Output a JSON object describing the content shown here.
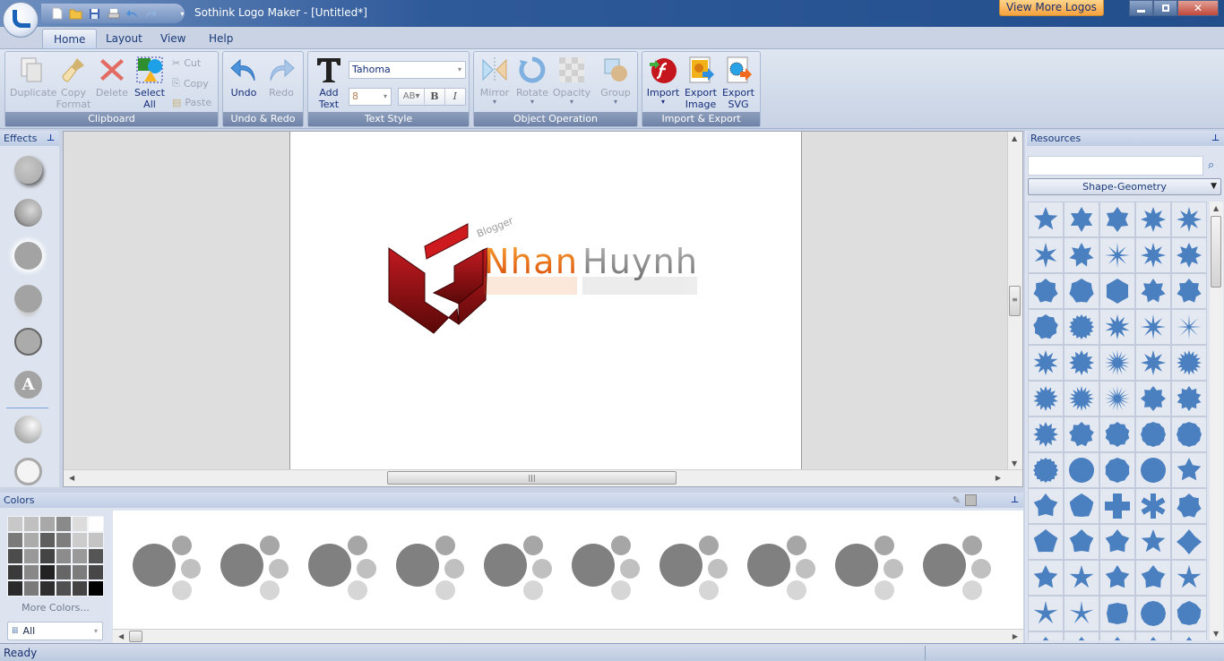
{
  "window": {
    "title": "Sothink Logo Maker - [Untitled*]",
    "view_more_label": "View More Logos",
    "minimize_icon": "minimize-icon",
    "restore_icon": "restore-icon",
    "close_icon": "close-icon"
  },
  "quick_access": [
    "new-icon",
    "open-icon",
    "save-icon",
    "print-icon",
    "undo-icon",
    "redo-icon",
    "customize-icon"
  ],
  "tabs": [
    {
      "label": "Home",
      "active": true
    },
    {
      "label": "Layout",
      "active": false
    },
    {
      "label": "View",
      "active": false
    },
    {
      "label": "Help",
      "active": false
    }
  ],
  "ribbon": {
    "clipboard": {
      "label": "Clipboard",
      "duplicate": "Duplicate",
      "copy_format_1": "Copy",
      "copy_format_2": "Format",
      "delete": "Delete",
      "select_all_1": "Select",
      "select_all_2": "All",
      "cut": "Cut",
      "copy": "Copy",
      "paste": "Paste"
    },
    "undo_redo": {
      "label": "Undo & Redo",
      "undo": "Undo",
      "redo": "Redo"
    },
    "text_style": {
      "label": "Text Style",
      "add_text_1": "Add",
      "add_text_2": "Text",
      "font": "Tahoma",
      "size": "8",
      "spacing": "AB",
      "bold": "B",
      "italic": "I"
    },
    "object_operation": {
      "label": "Object Operation",
      "mirror": "Mirror",
      "rotate": "Rotate",
      "opacity": "Opacity",
      "group": "Group"
    },
    "import_export": {
      "label": "Import & Export",
      "import": "Import",
      "export_image_1": "Export",
      "export_image_2": "Image",
      "export_svg_1": "Export",
      "export_svg_2": "SVG"
    }
  },
  "effects": {
    "title": "Effects",
    "items": [
      "drop-shadow",
      "bevel",
      "glow",
      "reflection",
      "stroke",
      "text-effect",
      "gradient",
      "outline"
    ]
  },
  "canvas": {
    "logo": {
      "tagline": "Blogger",
      "word1": "Nhan",
      "word2": "Huynh",
      "word1_color": "#e8620e",
      "word2_color": "#8a8a8a",
      "mark_color": "#a0121a"
    }
  },
  "resources": {
    "title": "Resources",
    "search_value": "",
    "category": "Shape-Geometry",
    "shape_color": "#4a7fc0"
  },
  "colors": {
    "title": "Colors",
    "swatches": [
      "#c8c8c8",
      "#c0c0c0",
      "#a8a8a8",
      "#8a8a8a",
      "#dcdcdc",
      "#ffffff",
      "#7a7a7a",
      "#ababab",
      "#5e5e5e",
      "#7e7e7e",
      "#cccccc",
      "#c4c4c4",
      "#4c4c4c",
      "#999999",
      "#444444",
      "#8c8c8c",
      "#9a9a9a",
      "#555555",
      "#3a3a3a",
      "#888888",
      "#222222",
      "#666666",
      "#7c7c7c",
      "#474747",
      "#2a2a2a",
      "#7a7a7a",
      "#2e2e2e",
      "#505050",
      "#444444",
      "#000000"
    ],
    "more_colors": "More Colors...",
    "filter": "All",
    "scheme_count": 10,
    "scheme_colors": [
      "#808080",
      "#a6a6a6",
      "#c0c0c0",
      "#d6d6d6"
    ]
  },
  "status": {
    "text": "Ready"
  }
}
